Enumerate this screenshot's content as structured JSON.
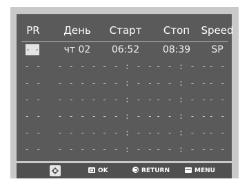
{
  "table": {
    "headers": {
      "pr": "PR",
      "day": "День",
      "start": "Старт",
      "stop": "Стоп",
      "speed": "Speed"
    },
    "rows": [
      {
        "pr": "- -",
        "day": "чт 02",
        "start": "06:52",
        "stop": "08:39",
        "speed": "SP"
      },
      {
        "pr": "- -",
        "day": "- -  - -",
        "start": "- - : - -",
        "stop": "- - : - -",
        "speed": "- -"
      },
      {
        "pr": "- -",
        "day": "- -  - -",
        "start": "- - : - -",
        "stop": "- - : - -",
        "speed": "- -"
      },
      {
        "pr": "- -",
        "day": "- -  - -",
        "start": "- - : - -",
        "stop": "- - : - -",
        "speed": "- -"
      },
      {
        "pr": "- -",
        "day": "- -  - -",
        "start": "- - : - -",
        "stop": "- - : - -",
        "speed": "- -"
      },
      {
        "pr": "- -",
        "day": "- -  - -",
        "start": "- - : - -",
        "stop": "- - : - -",
        "speed": "- -"
      },
      {
        "pr": "- -",
        "day": "- -  - -",
        "start": "- - : - -",
        "stop": "- - : - -",
        "speed": "- -"
      }
    ]
  },
  "nav": {
    "dpad_icon": "dpad-icon",
    "ok_label": "OK",
    "return_label": "RETURN",
    "menu_label": "MENU"
  },
  "colors": {
    "screen_bg": "#5a5a5a",
    "bezel_bg": "#c9c9cb",
    "nav_bg": "#505050",
    "text": "#ffffff"
  }
}
